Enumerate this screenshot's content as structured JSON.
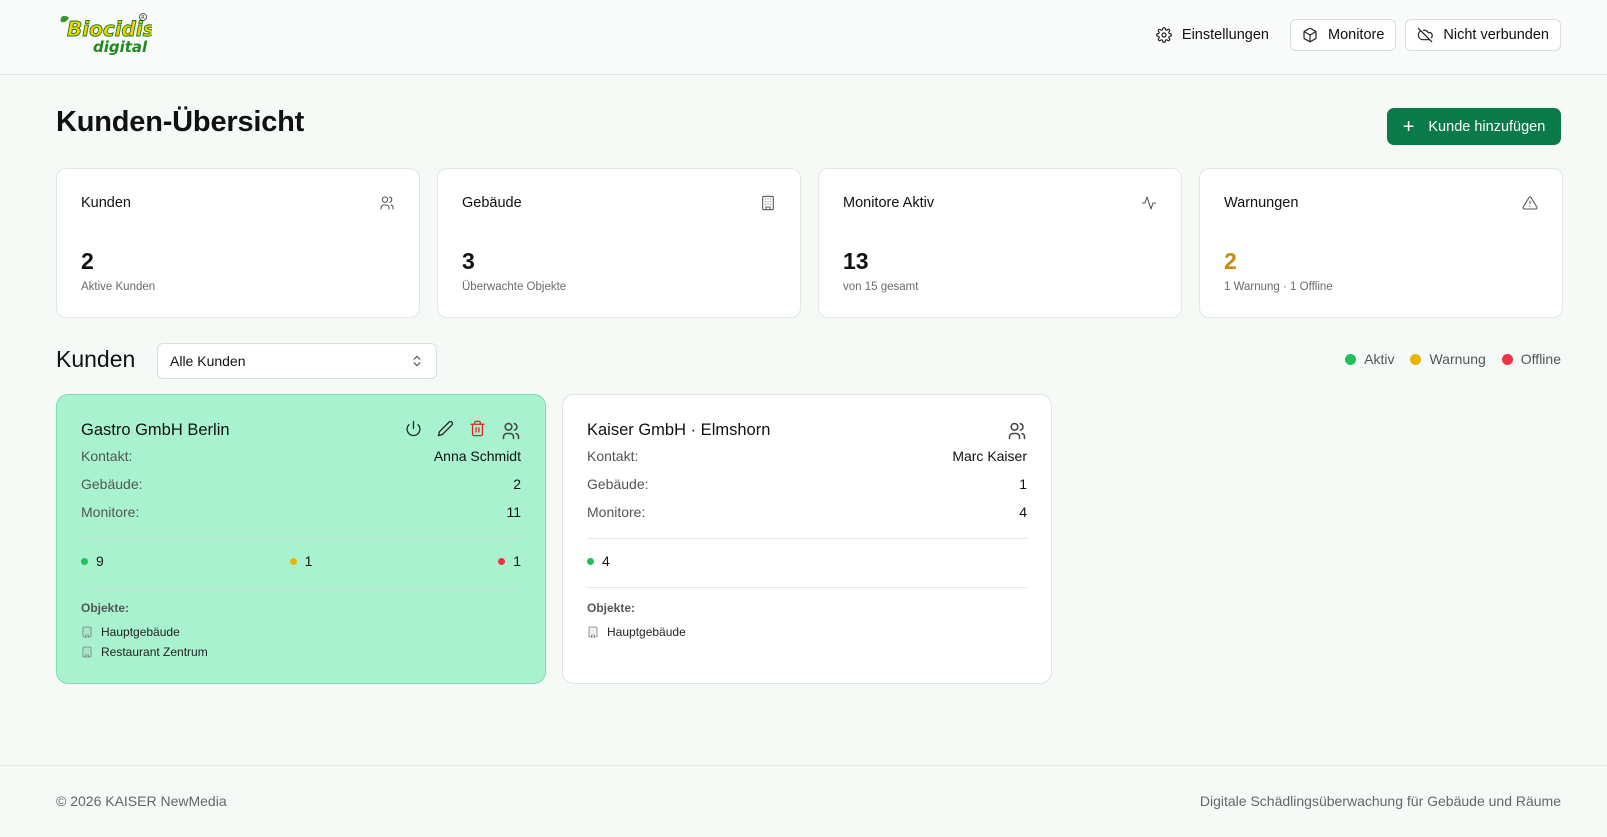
{
  "header": {
    "logo_text": "Biocidis digital",
    "nav": {
      "settings_label": "Einstellungen",
      "monitors_label": "Monitore",
      "connection_label": "Nicht verbunden"
    }
  },
  "page": {
    "title": "Kunden-Übersicht",
    "add_button_label": "Kunde hinzufügen"
  },
  "stats": [
    {
      "label": "Kunden",
      "value": "2",
      "sub": "Aktive Kunden",
      "icon": "users-icon"
    },
    {
      "label": "Gebäude",
      "value": "3",
      "sub": "Überwachte Objekte",
      "icon": "building-icon"
    },
    {
      "label": "Monitore Aktiv",
      "value": "13",
      "sub": "von 15 gesamt",
      "icon": "activity-icon"
    },
    {
      "label": "Warnungen",
      "value": "2",
      "sub": "1 Warnung · 1 Offline",
      "icon": "alert-triangle-icon",
      "value_color": "#c88a10"
    }
  ],
  "customers_section": {
    "title": "Kunden",
    "filter_value": "Alle Kunden",
    "legend": {
      "active": "Aktiv",
      "warning": "Warnung",
      "offline": "Offline"
    }
  },
  "customers": [
    {
      "name": "Gastro GmbH Berlin",
      "contact_label": "Kontakt:",
      "contact": "Anna Schmidt",
      "buildings_label": "Gebäude:",
      "buildings": "2",
      "monitors_label": "Monitore:",
      "monitors": "11",
      "active_count": "9",
      "warning_count": "1",
      "offline_count": "1",
      "objects_label": "Objekte:",
      "objects": [
        "Hauptgebäude",
        "Restaurant Zentrum"
      ]
    },
    {
      "name": "Kaiser GmbH · Elmshorn",
      "contact_label": "Kontakt:",
      "contact": "Marc Kaiser",
      "buildings_label": "Gebäude:",
      "buildings": "1",
      "monitors_label": "Monitore:",
      "monitors": "4",
      "active_count": "4",
      "objects_label": "Objekte:",
      "objects": [
        "Hauptgebäude"
      ]
    }
  ],
  "footer": {
    "copyright": "© 2026 KAISER NewMedia",
    "tagline": "Digitale Schädlingsüberwachung für Gebäude und Räume"
  },
  "colors": {
    "brand": "#0b7a4b",
    "selected_card": "#a8f2d0",
    "status_active": "#1ec05a",
    "status_warning": "#eab308",
    "status_offline": "#ef3340"
  }
}
